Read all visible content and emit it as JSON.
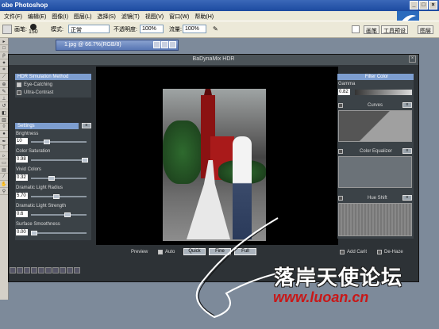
{
  "app": {
    "title": "Adobe Photoshop",
    "title_partial": "obe Photoshop",
    "window_controls": [
      "_",
      "□",
      "×"
    ]
  },
  "menu": {
    "items": [
      "文件(F)",
      "编辑(E)",
      "图像(I)",
      "图层(L)",
      "选择(S)",
      "滤镜(T)",
      "视图(V)",
      "窗口(W)",
      "帮助(H)"
    ]
  },
  "options": {
    "brush_label": "画笔:",
    "brush_size": "150",
    "mode_label": "模式:",
    "mode_value": "正常",
    "opacity_label": "不透明度:",
    "opacity_value": "100%",
    "flow_label": "流量:",
    "flow_value": "100%",
    "tabs": [
      "画笔",
      "工具预设",
      "图层"
    ]
  },
  "document": {
    "tab_title": "1.jpg @ 66.7%(RGB/8)"
  },
  "plugin": {
    "title": "BaDynaMix HDR",
    "simulation": {
      "header": "HDR Simulation Method",
      "options": [
        "Eye-Catching",
        "Ultra-Contrast"
      ]
    },
    "settings": {
      "header": "Settings",
      "fields": [
        {
          "label": "Brightness",
          "value": "10"
        },
        {
          "label": "Color Saturation",
          "value": "0.98"
        },
        {
          "label": "Vivid Colors",
          "value": "0.32"
        },
        {
          "label": "Dramatic Light Radius",
          "value": "5.70"
        },
        {
          "label": "Dramatic Light Strength",
          "value": "0.6"
        },
        {
          "label": "Surface Smoothness",
          "value": "0.00"
        }
      ]
    },
    "filter_color": {
      "header": "Filter Color",
      "gamma_label": "Gamma",
      "gamma_value": "0.82",
      "sections": [
        "Curves",
        "Color Equalizer",
        "Hue Shift"
      ]
    },
    "bottom": {
      "preview_label": "Preview",
      "auto_label": "Auto",
      "buttons": [
        "Quick",
        "Fine",
        "Full"
      ],
      "add_caret_label": "Add Carit",
      "de_haze_label": "De-Haze"
    }
  },
  "watermark": {
    "site_cn": "落岸天使论坛",
    "url": "www.luoan.cn"
  }
}
